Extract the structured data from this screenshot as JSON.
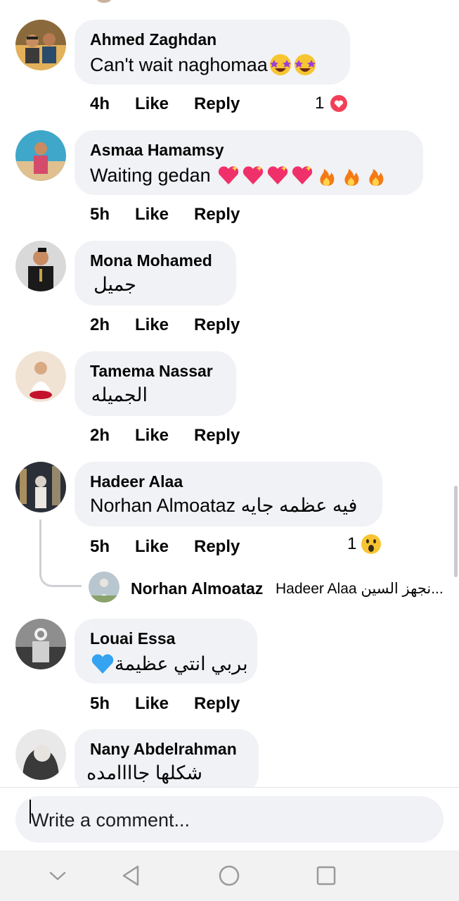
{
  "comments": [
    {
      "name": "Ahmed Zaghdan",
      "text": "Can't wait naghomaa",
      "emojis": [
        "star-struck",
        "star-struck"
      ],
      "time": "4h",
      "like": "Like",
      "reply": "Reply",
      "reaction": {
        "count": "1",
        "type": "love"
      }
    },
    {
      "name": "Asmaa Hamamsy",
      "text": "Waiting gedan ",
      "emojis": [
        "sparkling-heart",
        "sparkling-heart",
        "sparkling-heart",
        "sparkling-heart",
        "fire",
        "fire",
        "fire"
      ],
      "time": "5h",
      "like": "Like",
      "reply": "Reply"
    },
    {
      "name": "Mona Mohamed",
      "text": "جميل",
      "time": "2h",
      "like": "Like",
      "reply": "Reply"
    },
    {
      "name": "Tamema Nassar",
      "text": "الجميله",
      "time": "2h",
      "like": "Like",
      "reply": "Reply"
    },
    {
      "name": "Hadeer Alaa",
      "text": "Norhan Almoataz فيه عظمه جايه",
      "time": "5h",
      "like": "Like",
      "reply": "Reply",
      "reaction": {
        "count": "1",
        "type": "wow"
      },
      "replies_preview": {
        "name": "Norhan Almoataz",
        "text": "Hadeer Alaa نجهز السين..."
      }
    },
    {
      "name": "Louai Essa",
      "text": "بربي انتي عظيمة",
      "emojis": [
        "blue-heart"
      ],
      "time": "5h",
      "like": "Like",
      "reply": "Reply"
    },
    {
      "name": "Nany Abdelrahman",
      "text": "شكلها جاااامده"
    }
  ],
  "composer": {
    "placeholder": "Write a comment..."
  },
  "navigation": {
    "buttons": [
      "chevron-down-icon",
      "back-triangle-icon",
      "home-circle-icon",
      "recents-square-icon"
    ]
  },
  "colors": {
    "bubble": "#f0f2f5",
    "love": "#f33e58",
    "text": "#050505"
  }
}
